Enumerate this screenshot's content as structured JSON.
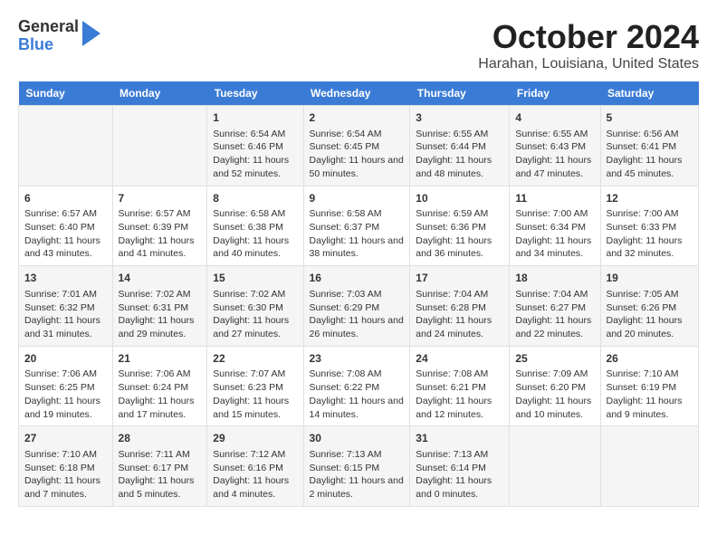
{
  "header": {
    "logo": {
      "line1": "General",
      "line2": "Blue"
    },
    "title": "October 2024",
    "subtitle": "Harahan, Louisiana, United States"
  },
  "days_of_week": [
    "Sunday",
    "Monday",
    "Tuesday",
    "Wednesday",
    "Thursday",
    "Friday",
    "Saturday"
  ],
  "weeks": [
    [
      {
        "day": "",
        "text": ""
      },
      {
        "day": "",
        "text": ""
      },
      {
        "day": "1",
        "text": "Sunrise: 6:54 AM\nSunset: 6:46 PM\nDaylight: 11 hours and 52 minutes."
      },
      {
        "day": "2",
        "text": "Sunrise: 6:54 AM\nSunset: 6:45 PM\nDaylight: 11 hours and 50 minutes."
      },
      {
        "day": "3",
        "text": "Sunrise: 6:55 AM\nSunset: 6:44 PM\nDaylight: 11 hours and 48 minutes."
      },
      {
        "day": "4",
        "text": "Sunrise: 6:55 AM\nSunset: 6:43 PM\nDaylight: 11 hours and 47 minutes."
      },
      {
        "day": "5",
        "text": "Sunrise: 6:56 AM\nSunset: 6:41 PM\nDaylight: 11 hours and 45 minutes."
      }
    ],
    [
      {
        "day": "6",
        "text": "Sunrise: 6:57 AM\nSunset: 6:40 PM\nDaylight: 11 hours and 43 minutes."
      },
      {
        "day": "7",
        "text": "Sunrise: 6:57 AM\nSunset: 6:39 PM\nDaylight: 11 hours and 41 minutes."
      },
      {
        "day": "8",
        "text": "Sunrise: 6:58 AM\nSunset: 6:38 PM\nDaylight: 11 hours and 40 minutes."
      },
      {
        "day": "9",
        "text": "Sunrise: 6:58 AM\nSunset: 6:37 PM\nDaylight: 11 hours and 38 minutes."
      },
      {
        "day": "10",
        "text": "Sunrise: 6:59 AM\nSunset: 6:36 PM\nDaylight: 11 hours and 36 minutes."
      },
      {
        "day": "11",
        "text": "Sunrise: 7:00 AM\nSunset: 6:34 PM\nDaylight: 11 hours and 34 minutes."
      },
      {
        "day": "12",
        "text": "Sunrise: 7:00 AM\nSunset: 6:33 PM\nDaylight: 11 hours and 32 minutes."
      }
    ],
    [
      {
        "day": "13",
        "text": "Sunrise: 7:01 AM\nSunset: 6:32 PM\nDaylight: 11 hours and 31 minutes."
      },
      {
        "day": "14",
        "text": "Sunrise: 7:02 AM\nSunset: 6:31 PM\nDaylight: 11 hours and 29 minutes."
      },
      {
        "day": "15",
        "text": "Sunrise: 7:02 AM\nSunset: 6:30 PM\nDaylight: 11 hours and 27 minutes."
      },
      {
        "day": "16",
        "text": "Sunrise: 7:03 AM\nSunset: 6:29 PM\nDaylight: 11 hours and 26 minutes."
      },
      {
        "day": "17",
        "text": "Sunrise: 7:04 AM\nSunset: 6:28 PM\nDaylight: 11 hours and 24 minutes."
      },
      {
        "day": "18",
        "text": "Sunrise: 7:04 AM\nSunset: 6:27 PM\nDaylight: 11 hours and 22 minutes."
      },
      {
        "day": "19",
        "text": "Sunrise: 7:05 AM\nSunset: 6:26 PM\nDaylight: 11 hours and 20 minutes."
      }
    ],
    [
      {
        "day": "20",
        "text": "Sunrise: 7:06 AM\nSunset: 6:25 PM\nDaylight: 11 hours and 19 minutes."
      },
      {
        "day": "21",
        "text": "Sunrise: 7:06 AM\nSunset: 6:24 PM\nDaylight: 11 hours and 17 minutes."
      },
      {
        "day": "22",
        "text": "Sunrise: 7:07 AM\nSunset: 6:23 PM\nDaylight: 11 hours and 15 minutes."
      },
      {
        "day": "23",
        "text": "Sunrise: 7:08 AM\nSunset: 6:22 PM\nDaylight: 11 hours and 14 minutes."
      },
      {
        "day": "24",
        "text": "Sunrise: 7:08 AM\nSunset: 6:21 PM\nDaylight: 11 hours and 12 minutes."
      },
      {
        "day": "25",
        "text": "Sunrise: 7:09 AM\nSunset: 6:20 PM\nDaylight: 11 hours and 10 minutes."
      },
      {
        "day": "26",
        "text": "Sunrise: 7:10 AM\nSunset: 6:19 PM\nDaylight: 11 hours and 9 minutes."
      }
    ],
    [
      {
        "day": "27",
        "text": "Sunrise: 7:10 AM\nSunset: 6:18 PM\nDaylight: 11 hours and 7 minutes."
      },
      {
        "day": "28",
        "text": "Sunrise: 7:11 AM\nSunset: 6:17 PM\nDaylight: 11 hours and 5 minutes."
      },
      {
        "day": "29",
        "text": "Sunrise: 7:12 AM\nSunset: 6:16 PM\nDaylight: 11 hours and 4 minutes."
      },
      {
        "day": "30",
        "text": "Sunrise: 7:13 AM\nSunset: 6:15 PM\nDaylight: 11 hours and 2 minutes."
      },
      {
        "day": "31",
        "text": "Sunrise: 7:13 AM\nSunset: 6:14 PM\nDaylight: 11 hours and 0 minutes."
      },
      {
        "day": "",
        "text": ""
      },
      {
        "day": "",
        "text": ""
      }
    ]
  ]
}
